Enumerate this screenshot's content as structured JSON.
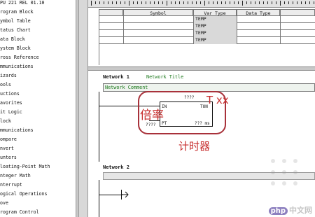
{
  "tree": {
    "items": [
      "PU 221 REL 01.10",
      "rogram Block",
      "ymbol Table",
      "tatus Chart",
      "ata Block",
      "ystem Block",
      "ross Reference",
      "mmunications",
      "izards",
      "ools",
      "uctions",
      "avorites",
      "it Logic",
      "lock",
      "mmunications",
      "ompare",
      "nvert",
      "unters",
      "loating-Point Math",
      "nteger Math",
      "nterrupt",
      "ogical Operations",
      "ove",
      "rogram Control"
    ]
  },
  "var_table": {
    "headers": [
      "Symbol",
      "Var Type",
      "Data Type"
    ],
    "rows": [
      {
        "var_type": "TEMP"
      },
      {
        "var_type": "TEMP"
      },
      {
        "var_type": "TEMP"
      },
      {
        "var_type": "TEMP"
      }
    ]
  },
  "network1": {
    "label": "Network 1",
    "title": "Network Title",
    "comment": "Network Comment",
    "timer": {
      "top_name": "????",
      "in_label": "IN",
      "ton_label": "TON",
      "pt_label": "PT",
      "pt_value": "????",
      "unit_label": "??? ms"
    }
  },
  "annotations": {
    "tx": "T xx",
    "multiplier": "倍率",
    "timer": "计时器"
  },
  "network2": {
    "label": "Network 2"
  },
  "watermark": {
    "icon_text": "php",
    "site": "中文网"
  },
  "colors": {
    "annotation_red": "#c62b2b",
    "comment_green": "#1e7a1e"
  }
}
